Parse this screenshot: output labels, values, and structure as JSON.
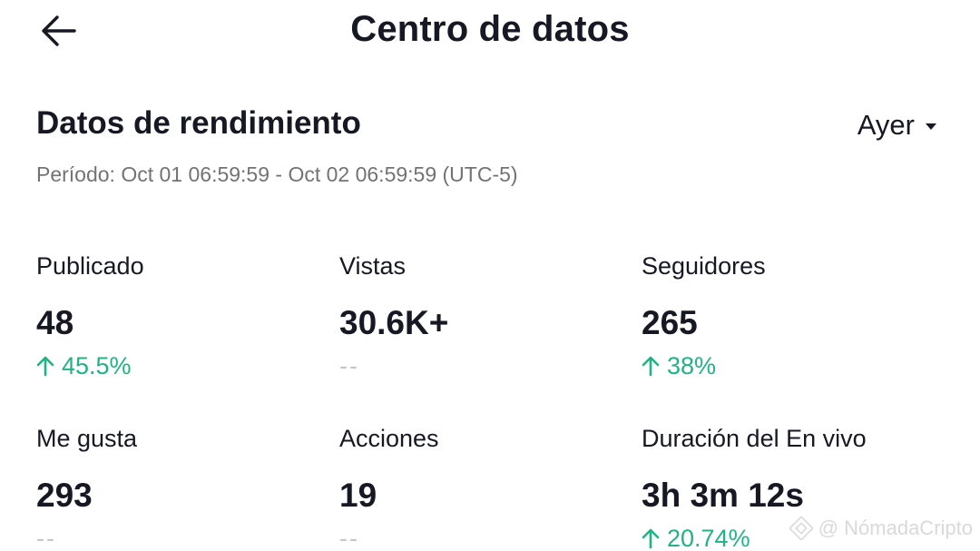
{
  "header": {
    "title": "Centro de datos"
  },
  "performance": {
    "title": "Datos de rendimiento",
    "range_label": "Ayer",
    "period": "Período: Oct 01 06:59:59 - Oct 02 06:59:59 (UTC-5)"
  },
  "metrics": [
    {
      "label": "Publicado",
      "value": "48",
      "change": "45.5%",
      "trend": "up"
    },
    {
      "label": "Vistas",
      "value": "30.6K+",
      "change": "--",
      "trend": "none"
    },
    {
      "label": "Seguidores",
      "value": "265",
      "change": "38%",
      "trend": "up"
    },
    {
      "label": "Me gusta",
      "value": "293",
      "change": "--",
      "trend": "none"
    },
    {
      "label": "Acciones",
      "value": "19",
      "change": "--",
      "trend": "none"
    },
    {
      "label": "Duración del En vivo",
      "value": "3h 3m 12s",
      "change": "20.74%",
      "trend": "up"
    }
  ],
  "watermark": {
    "text": "@ NómadaCripto",
    "icon": "binance-logo-icon"
  },
  "colors": {
    "text": "#161823",
    "muted": "#737373",
    "positive": "#20b384",
    "placeholder": "#c6c6c6"
  },
  "icons": {
    "back": "arrow-left-icon",
    "dropdown": "caret-down-icon",
    "trend_up": "arrow-up-icon"
  }
}
